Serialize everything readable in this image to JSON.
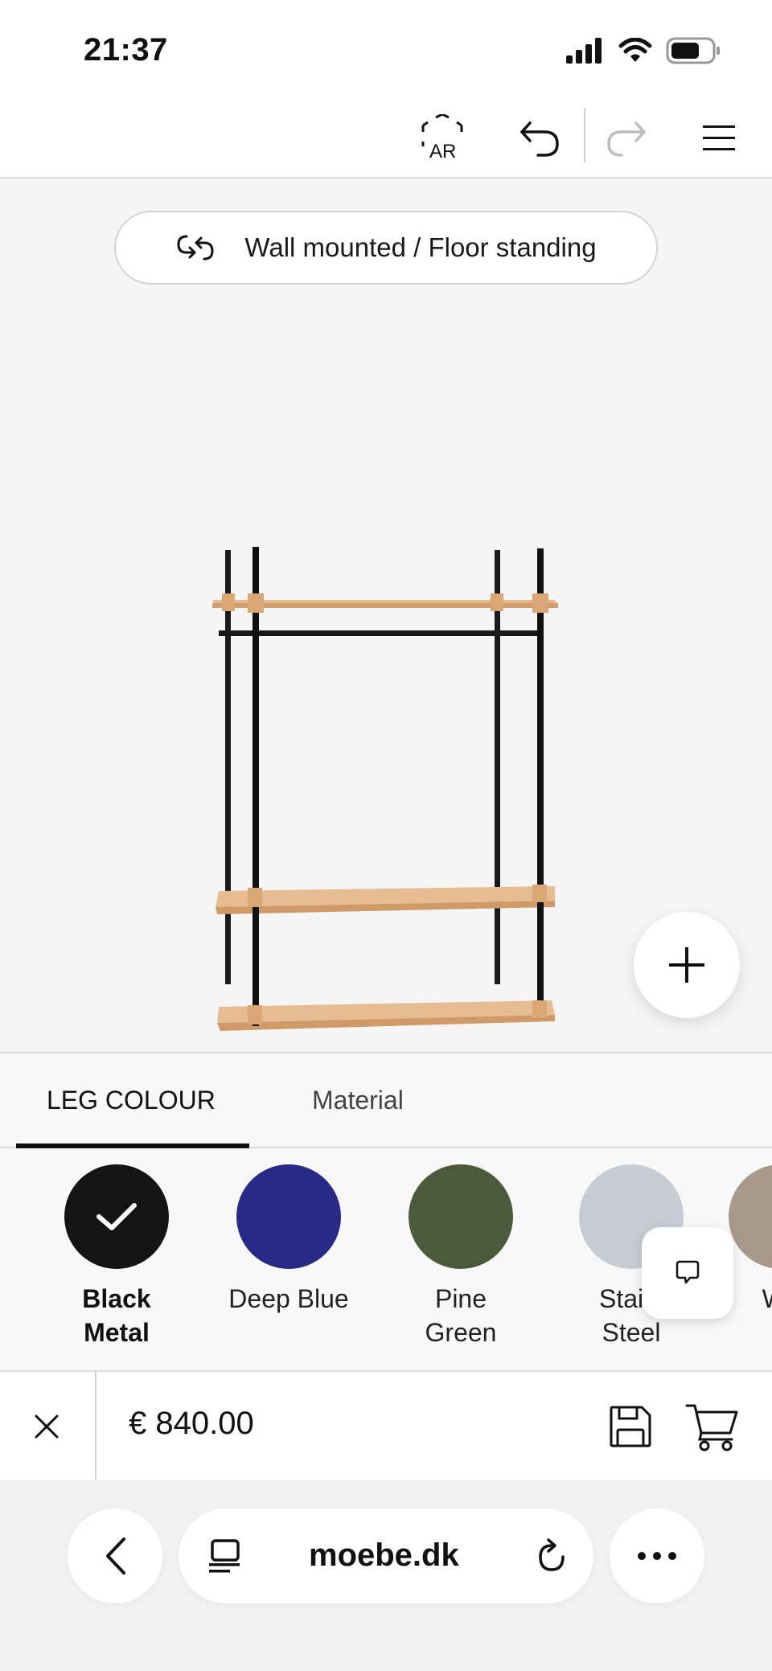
{
  "status_bar": {
    "time": "21:37"
  },
  "toolbar": {
    "ar_label": "AR"
  },
  "canvas": {
    "mount_toggle_label": "Wall mounted / Floor standing"
  },
  "tabs": [
    {
      "label": "LEG COLOUR",
      "active": true
    },
    {
      "label": "Material",
      "active": false
    }
  ],
  "swatches": [
    {
      "line1": "Black",
      "line2": "Metal",
      "color": "#141414",
      "selected": true
    },
    {
      "line1": "Deep Blue",
      "line2": "",
      "color": "#272a86",
      "selected": false
    },
    {
      "line1": "Pine",
      "line2": "Green",
      "color": "#4a5a3a",
      "selected": false
    },
    {
      "line1": "Stainl",
      "line2": "Steel",
      "color": "#c7ccd3",
      "selected": false
    },
    {
      "line1": "Wa",
      "line2": "",
      "color": "#a8998a",
      "selected": false
    }
  ],
  "price_bar": {
    "price": "€ 840.00"
  },
  "browser": {
    "url": "moebe.dk"
  },
  "colors": {
    "accent": "#111111",
    "background": "#f5f5f5",
    "shelf_wood": "#e0b58c"
  }
}
